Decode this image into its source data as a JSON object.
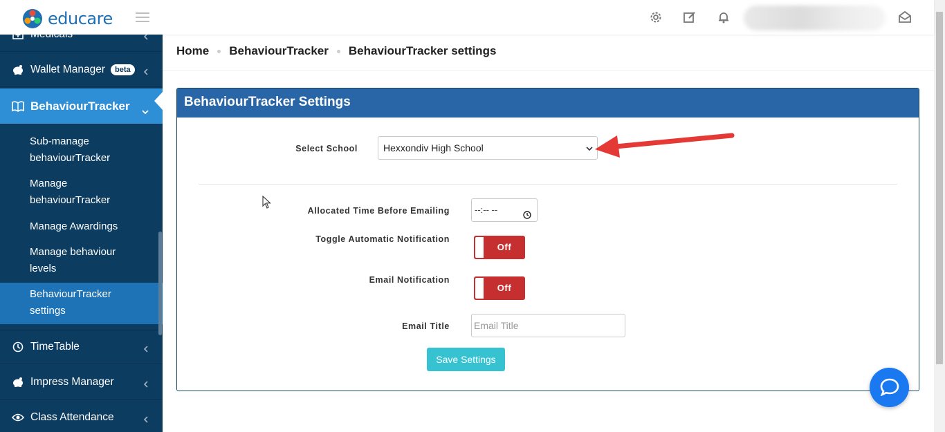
{
  "app": {
    "logo_text": "educare"
  },
  "topbar": {
    "icons": [
      "gear-icon",
      "edit-icon",
      "bell-icon",
      "mail-open-icon"
    ]
  },
  "sidebar": {
    "items": [
      {
        "label": "Medicals"
      },
      {
        "label": "Wallet Manager",
        "badge": "beta"
      },
      {
        "label": "BehaviourTracker"
      },
      {
        "label": "TimeTable"
      },
      {
        "label": "Impress Manager"
      },
      {
        "label": "Class Attendance"
      }
    ],
    "sub_items": [
      {
        "label": "Sub-manage behaviourTracker"
      },
      {
        "label": "Manage behaviourTracker"
      },
      {
        "label": "Manage Awardings"
      },
      {
        "label": "Manage behaviour levels"
      },
      {
        "label": "BehaviourTracker settings"
      }
    ]
  },
  "breadcrumb": [
    "Home",
    "BehaviourTracker",
    "BehaviourTracker settings"
  ],
  "panel": {
    "title": "BehaviourTracker Settings",
    "select_school_label": "Select School",
    "select_school_value": "Hexxondiv High School",
    "allocated_time_label": "Allocated Time Before Emailing",
    "allocated_time_value": "--:-- --",
    "auto_notify_label": "Toggle Automatic Notification",
    "auto_notify_state": "Off",
    "email_notify_label": "Email Notification",
    "email_notify_state": "Off",
    "email_title_label": "Email Title",
    "email_title_placeholder": "Email Title",
    "save_label": "Save Settings"
  },
  "colors": {
    "sidebar": "#0d3c61",
    "active": "#2e8fd6",
    "panel_header": "#2966a8",
    "toggle_off": "#c62f2f",
    "save": "#37c2d1",
    "chat": "#1a78f0"
  }
}
